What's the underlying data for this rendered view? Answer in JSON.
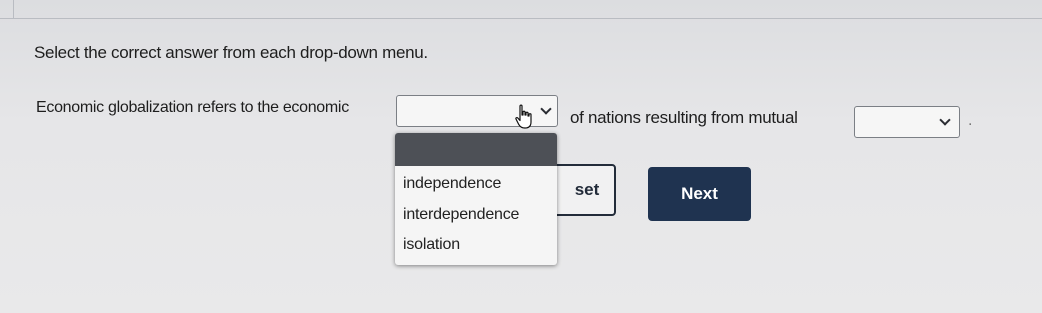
{
  "instructions": "Select the correct answer from each drop-down menu.",
  "question": {
    "part1": "Economic globalization refers to the economic",
    "part2": "of nations resulting from mutual",
    "part3": "."
  },
  "dropdown1": {
    "selected": "",
    "options": [
      "independence",
      "interdependence",
      "isolation"
    ]
  },
  "dropdown2": {
    "selected": ""
  },
  "buttons": {
    "reset_label": "Reset",
    "reset_visible": "set",
    "next_label": "Next"
  },
  "colors": {
    "next_bg": "#1f3350",
    "reset_border": "#232c3a",
    "menu_header": "#4d5056"
  },
  "icons": {
    "dropdown": "chevron-down-icon",
    "cursor": "hand-pointer-icon"
  }
}
